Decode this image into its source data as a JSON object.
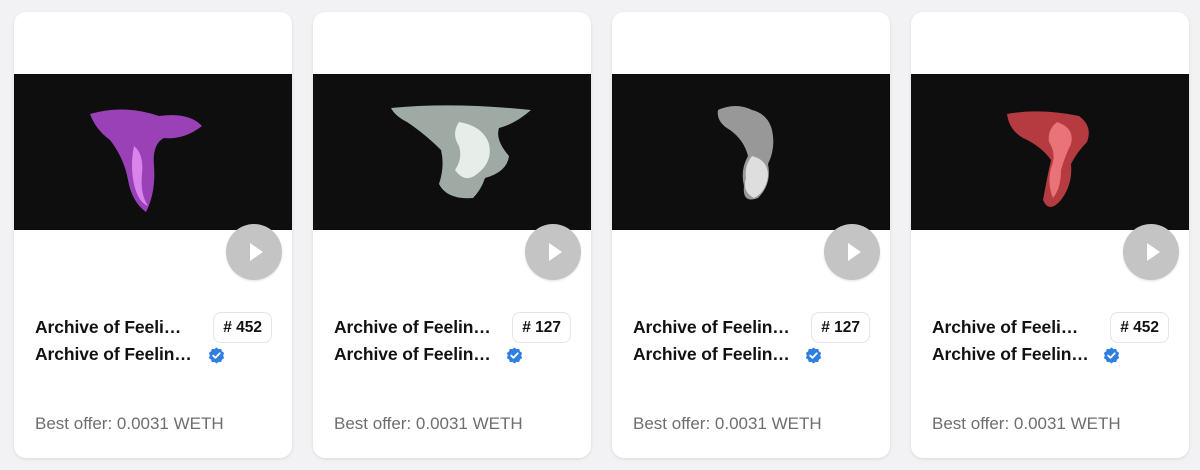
{
  "cards": [
    {
      "collection_title": "Archive of Feeli…",
      "item_title": "Archive of Feelin…",
      "token_number": "# 452",
      "best_offer": "Best offer: 0.0031 WETH",
      "smoke_color": "#b44ad6",
      "smoke_highlight": "#e08cf2",
      "media_icon": "play-icon"
    },
    {
      "collection_title": "Archive of Feelin…",
      "item_title": "Archive of Feelin…",
      "token_number": "# 127",
      "best_offer": "Best offer: 0.0031 WETH",
      "smoke_color": "#b9c6c0",
      "smoke_highlight": "#eef5f1",
      "media_icon": "play-icon"
    },
    {
      "collection_title": "Archive of Feelin…",
      "item_title": "Archive of Feelin…",
      "token_number": "# 127",
      "best_offer": "Best offer: 0.0031 WETH",
      "smoke_color": "#b0b0b0",
      "smoke_highlight": "#e6e6e6",
      "media_icon": "play-icon"
    },
    {
      "collection_title": "Archive of Feeli…",
      "item_title": "Archive of Feelin…",
      "token_number": "# 452",
      "best_offer": "Best offer: 0.0031 WETH",
      "smoke_color": "#d2434a",
      "smoke_highlight": "#ef7a80",
      "media_icon": "play-icon"
    }
  ],
  "colors": {
    "verified_badge": "#2f7fe0",
    "play_button": "#c4c4c4",
    "media_background": "#0e0e0e"
  }
}
